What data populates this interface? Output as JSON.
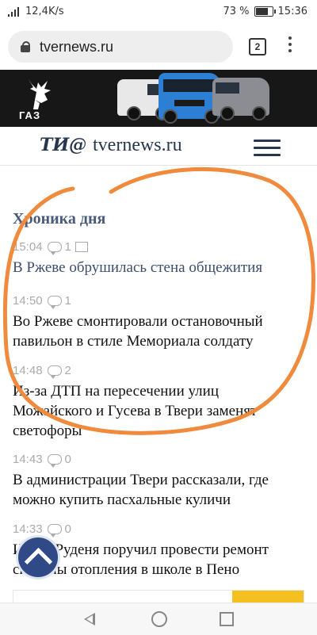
{
  "status_bar": {
    "network_label": "⁴⁶",
    "speed": "12,4K/s",
    "battery_percent": "73 %",
    "battery_level": 0.73,
    "time": "15:36"
  },
  "browser": {
    "url": "tvernews.ru",
    "tab_count": "2"
  },
  "banner": {
    "brand": "ГАЗ"
  },
  "site_header": {
    "logo_text": "ТИ@",
    "site_name": "tvernews.ru"
  },
  "section_title": "Хроника дня",
  "news": [
    {
      "time": "15:04",
      "comments": "1",
      "has_photo": true,
      "headline": "В Ржеве обрушилась стена общежития",
      "visited": true
    },
    {
      "time": "14:50",
      "comments": "1",
      "has_photo": false,
      "headline": "Во Ржеве смонтировали остановочный павильон в стиле Мемориала солдату",
      "visited": false
    },
    {
      "time": "14:48",
      "comments": "2",
      "has_photo": false,
      "headline": "Из-за ДТП на пересечении улиц Можайского и Гусева в Твери заменят светофоры",
      "visited": false
    },
    {
      "time": "14:43",
      "comments": "0",
      "has_photo": false,
      "headline": "В администрации Твери рассказали, где можно купить пасхальные куличи",
      "visited": false
    },
    {
      "time": "14:33",
      "comments": "0",
      "has_photo": false,
      "headline": "Игорь Руденя поручил провести ремонт системы отопления в школе в Пено",
      "visited": false
    }
  ],
  "colors": {
    "annotation": "#f08a3c",
    "accent": "#2f4a86",
    "title": "#4a5b7a"
  }
}
